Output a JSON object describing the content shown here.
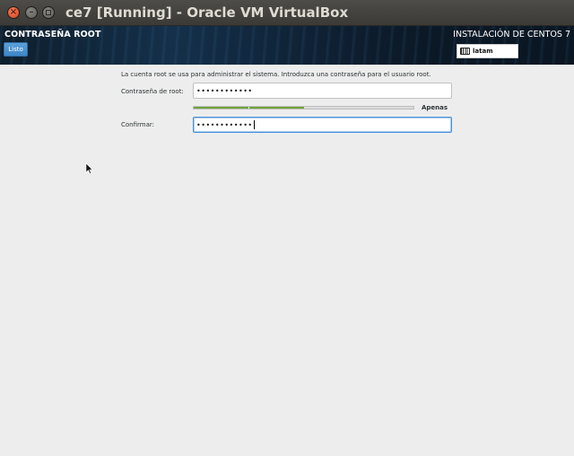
{
  "window": {
    "title": "ce7 [Running] - Oracle VM VirtualBox"
  },
  "header": {
    "spoke_title": "CONTRASEÑA ROOT",
    "done_label": "Listo",
    "product_title": "INSTALACIÓN DE CENTOS 7",
    "keyboard_layout": "latam"
  },
  "form": {
    "info_text": "La cuenta root se usa para administrar el sistema. Introduzca una contraseña para el usuario root.",
    "root_password_label": "Contraseña de root:",
    "root_password_value": "••••••••••••",
    "strength_fraction": 0.5,
    "strength_label": "Apenas",
    "confirm_label": "Confirmar:",
    "confirm_value": "••••••••••••"
  },
  "colors": {
    "header_dark": "#0e1e2c",
    "done_button": "#4a90d9",
    "strength_bar": "#6fa53a",
    "background": "#ededed"
  }
}
